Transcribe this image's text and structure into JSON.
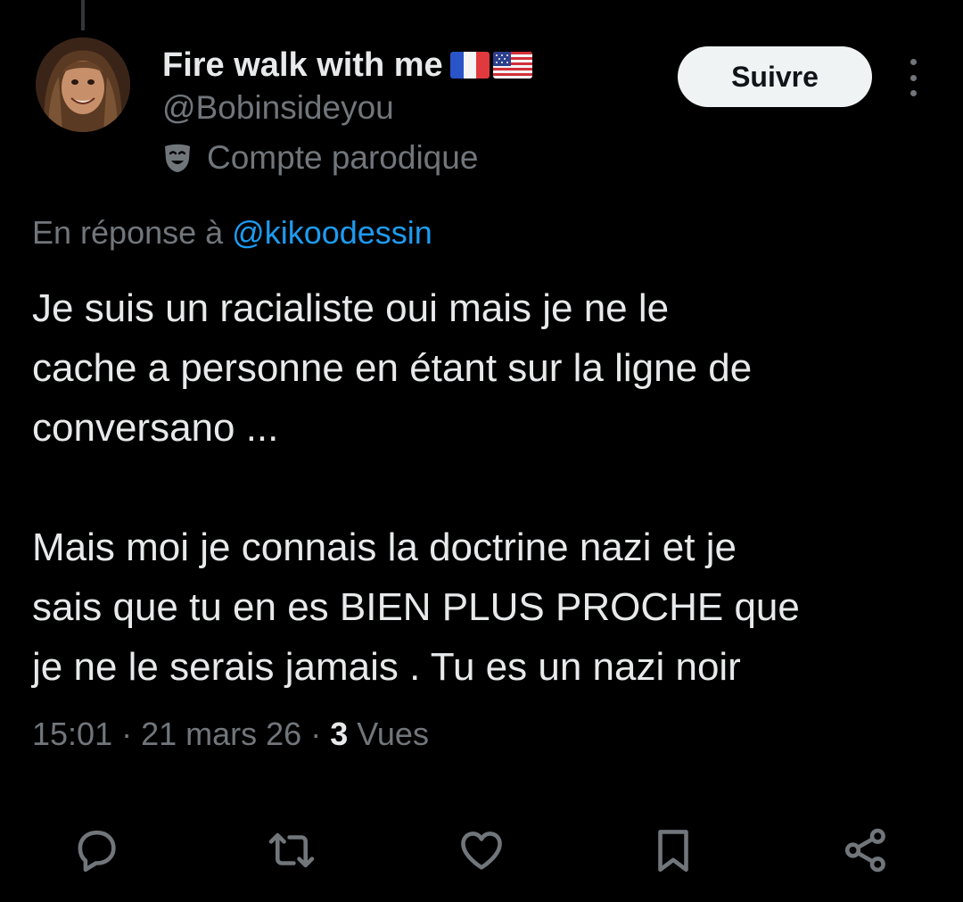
{
  "author": {
    "display_name": "Fire walk with me",
    "flags": [
      "flag-france-icon",
      "flag-usa-icon"
    ],
    "handle": "@Bobinsideyou",
    "parody_label": "Compte parodique"
  },
  "follow_button": {
    "label": "Suivre"
  },
  "reply_context": {
    "prefix": "En réponse à ",
    "handle": "@kikoodessin"
  },
  "tweet": {
    "paragraphs": [
      "Je suis un racialiste oui mais je ne le\ncache a personne en étant sur la ligne de\nconversano ...",
      "Mais moi je connais la doctrine nazi et je\nsais que tu en es BIEN PLUS PROCHE que\nje ne le serais jamais . Tu es un nazi noir"
    ]
  },
  "meta": {
    "time": "15:01",
    "separator": " · ",
    "date": "21 mars 26",
    "views_count": "3",
    "views_label": " Vues"
  },
  "actions": [
    "reply-icon",
    "repost-icon",
    "like-icon",
    "bookmark-icon",
    "share-icon"
  ],
  "colors": {
    "background": "#000000",
    "text_primary": "#e7e9ea",
    "text_secondary": "#71767b",
    "link": "#1d9bf0",
    "follow_button_bg": "#eff3f4"
  }
}
